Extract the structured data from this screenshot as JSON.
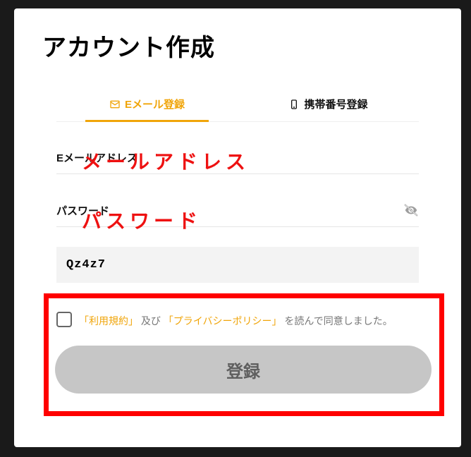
{
  "title": "アカウント作成",
  "tabs": {
    "email": {
      "label": "Eメール登録",
      "active": true
    },
    "phone": {
      "label": "携帯番号登録",
      "active": false
    }
  },
  "fields": {
    "email": {
      "label": "Eメールアドレス"
    },
    "password": {
      "label": "パスワード"
    }
  },
  "captcha": {
    "value": "Qz4z7"
  },
  "consent": {
    "prefix": "「",
    "terms": "利用規約",
    "mid1": "」",
    "and": "及び",
    "mid2": "「",
    "privacy": "プライバシーポリシー",
    "suffix": "」",
    "rest": "を読んで同意しました。"
  },
  "submit": {
    "label": "登録"
  },
  "annotations": {
    "a1": "メールアドレス",
    "a2": "パスワード"
  },
  "colors": {
    "accent": "#f0a50a",
    "highlight": "#f00"
  }
}
